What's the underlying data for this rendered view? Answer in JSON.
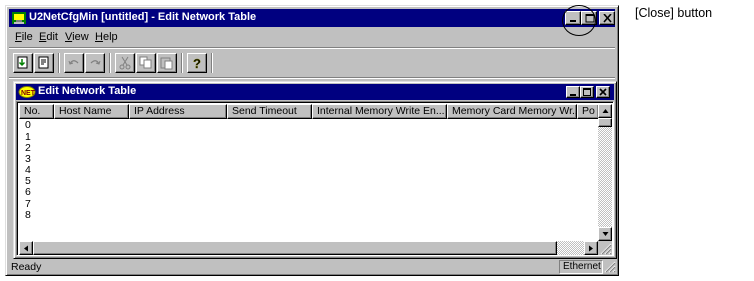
{
  "window": {
    "title": "U2NetCfgMin [untitled]  - Edit Network Table"
  },
  "menu": {
    "items": [
      {
        "label": "File",
        "accel": "F",
        "rest": "ile"
      },
      {
        "label": "Edit",
        "accel": "E",
        "rest": "dit"
      },
      {
        "label": "View",
        "accel": "V",
        "rest": "iew"
      },
      {
        "label": "Help",
        "accel": "H",
        "rest": "elp"
      }
    ]
  },
  "toolbar": {
    "buttons": [
      "download-icon",
      "upload-icon",
      "undo-icon",
      "redo-icon",
      "cut-icon",
      "copy-icon",
      "paste-icon",
      "help-icon"
    ]
  },
  "child_window": {
    "title": "Edit Network Table",
    "columns": [
      "No.",
      "Host Name",
      "IP Address",
      "Send Timeout",
      "Internal Memory Write En...",
      "Memory Card Memory Wr...",
      "Po"
    ],
    "rows": [
      "0",
      "1",
      "2",
      "3",
      "4",
      "5",
      "6",
      "7",
      "8"
    ]
  },
  "status": {
    "text": "Ready",
    "panel": "Ethernet"
  },
  "annotation": {
    "label": "[Close] button"
  },
  "colors": {
    "titlebar": "#000080",
    "face": "#c0c0c0"
  }
}
